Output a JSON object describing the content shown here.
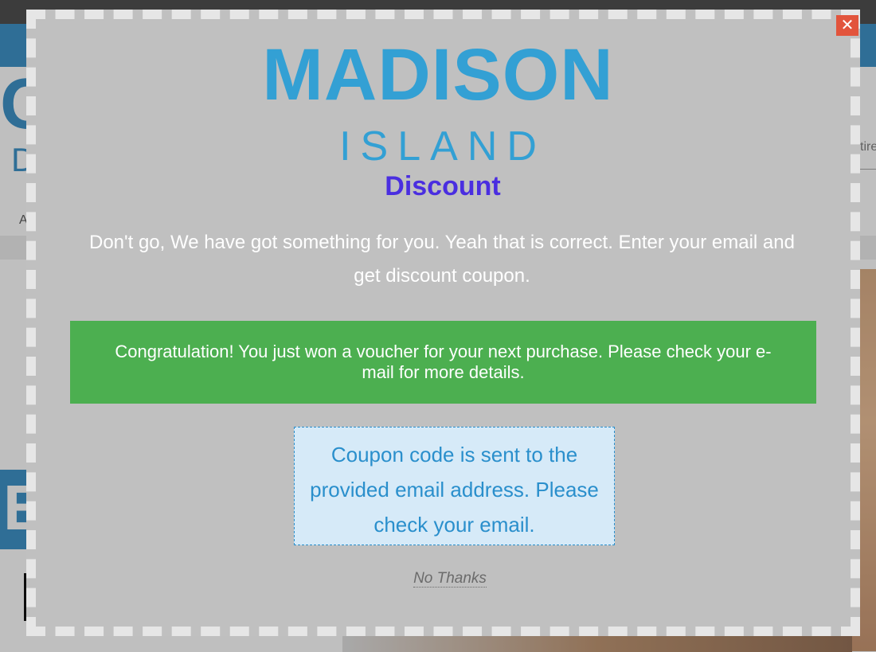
{
  "popup": {
    "logo_main": "MADISON",
    "logo_sub": "ISLAND",
    "title": "Discount",
    "promo_text": "Don't go, We have got something for you. Yeah that is correct. Enter your email and get discount coupon.",
    "success_message": "Congratulation! You just won a voucher for your next purchase. Please check your e-mail for more details.",
    "coupon_message": "Coupon code is sent to the provided email address. Please check your email.",
    "no_thanks_label": "No Thanks",
    "close_label": "✕"
  },
  "background": {
    "search_fragment": "tire"
  },
  "colors": {
    "logo": "#33a0d4",
    "title": "#4a2ee0",
    "success": "#4caf50",
    "coupon_bg": "#d6eaf8",
    "close": "#e2543c"
  }
}
